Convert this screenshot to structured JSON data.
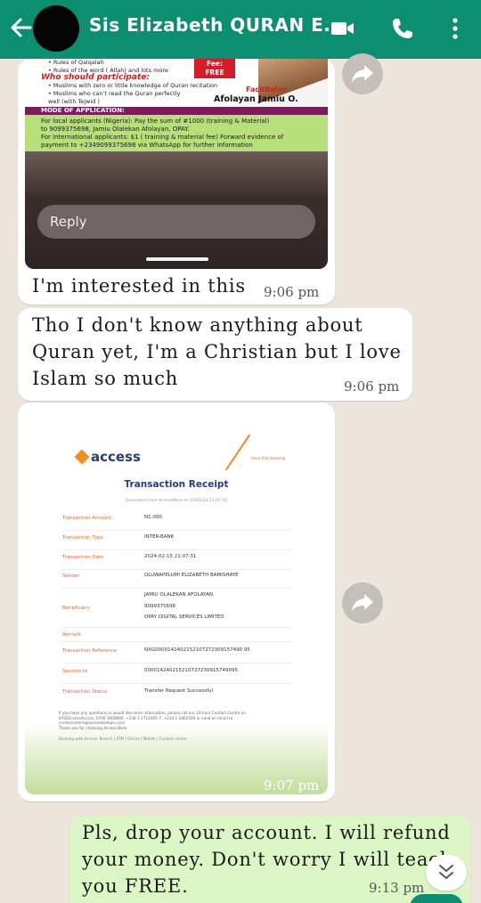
{
  "header": {
    "contact_name": "Sis Elizabeth QURAN E..."
  },
  "flyer": {
    "list_line1": "• Rules of Qalqalah",
    "list_line2": "• Rules of the word ( Allah) and lots more",
    "who_heading": "Who should participate:",
    "who_line1": "• Muslims with zero or little knowledge of Quran recitation",
    "who_line2": "• Muslims who can't read the Quran perfectly",
    "who_line3": "well (with Tejwid )",
    "fee_label": "Fee:",
    "fee_value": "FREE",
    "facilitator_label": "Facilitator",
    "facilitator_name": "Afolayan Jamiu O.",
    "mode_heading": "MODE OF APPLICATION:",
    "local_line1": "For local applicants (Nigeria): Pay the sum of #1000 (training & Material)",
    "local_line2": "to 9099375698, Jamiu Olalekan Afolayan, OPAY.",
    "intl_line1": "For international applicants: $1 ( training & material fee) Forward evidence of",
    "intl_line2": "payment to +2349099375698 via WhatsApp for further information",
    "reply_placeholder": "Reply"
  },
  "messages": [
    {
      "text": "I'm interested in this",
      "time": "9:06 pm"
    },
    {
      "text_line1": "Tho I don't know anything about",
      "text_line2": "Quran yet, I'm a Christian but I love",
      "text_line3": "Islam so much",
      "time": "9:06 pm"
    },
    {
      "time": "9:07 pm"
    },
    {
      "text_line1": "Pls, drop your account. I will refund",
      "text_line2": "your money. Don't worry I will teach",
      "text_line3": "you FREE.",
      "time": "9:13 pm"
    }
  ],
  "receipt": {
    "logo_text": "access",
    "tagline": "more than banking",
    "title": "Transaction Receipt",
    "generated": "Generated from AccessMore on 15/02/24 21:07:35",
    "rows": [
      {
        "label": "Transaction Amount",
        "value": "N1,000"
      },
      {
        "label": "Transaction Type",
        "value": "INTER-BANK"
      },
      {
        "label": "Transaction Date",
        "value": "2024-02-15 21:07:31"
      },
      {
        "label": "Sender",
        "value": "OLUWAPELUMI ELIZABETH BAMISHAYE"
      },
      {
        "label": "Beneficiary",
        "value1": "JAMIU OLALEKAN AFOLAYAN",
        "value2": "9099375698",
        "value3": "OPAY DIGITAL SERVICES LIMITED"
      },
      {
        "label": "Remark",
        "value": ""
      },
      {
        "label": "Transaction Reference",
        "value": "NXG0000142402152107272309157490 95"
      },
      {
        "label": "Session Id",
        "value": "000014240215210727230915749095"
      },
      {
        "label": "Transaction Status",
        "value": "Transfer Request Successful"
      }
    ],
    "footer1": "If you have any questions or would like more information, please call our 24-hour Contact Centre on",
    "footer2": "07002ccessAccess, 0700 3000000, +234 1-2712005-7, +234 1-2802500 or send an email to",
    "footer3": "contactcentre@accessbankplc.com",
    "footer4": "Thank you for choosing Access Bank",
    "footer5": "Banking with Access: Branch | ATM | Online | Mobile | Contact centre"
  }
}
